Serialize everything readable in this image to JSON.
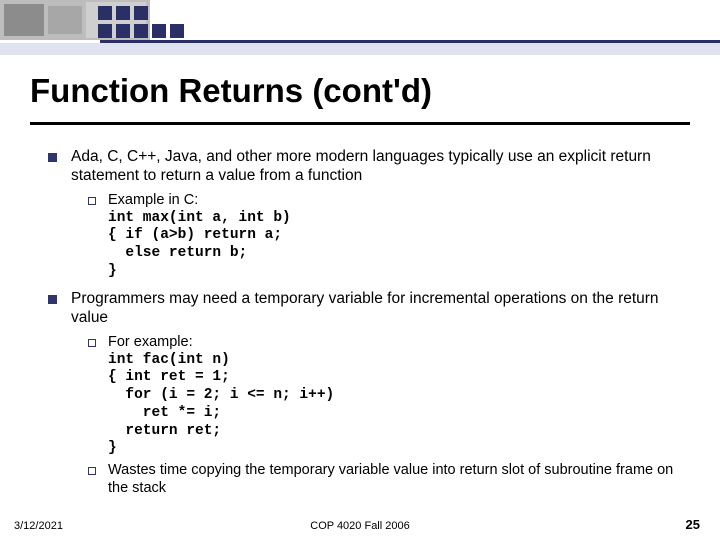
{
  "title": "Function Returns (cont'd)",
  "bullets": [
    {
      "text": "Ada, C, C++, Java, and other more modern languages typically use an explicit return statement to return a value from a function",
      "sub": [
        {
          "lead": "Example in C:",
          "code": "int max(int a, int b)\n{ if (a>b) return a;\n  else return b;\n}"
        }
      ]
    },
    {
      "text": "Programmers may need a temporary variable for incremental operations on the return value",
      "sub": [
        {
          "lead": "For example:",
          "code": "int fac(int n)\n{ int ret = 1;\n  for (i = 2; i <= n; i++)\n    ret *= i;\n  return ret;\n}"
        },
        {
          "lead": "Wastes time copying the temporary variable value into return slot of subroutine frame on the stack"
        }
      ]
    }
  ],
  "footer": {
    "date": "3/12/2021",
    "course": "COP 4020 Fall 2006",
    "page": "25"
  }
}
